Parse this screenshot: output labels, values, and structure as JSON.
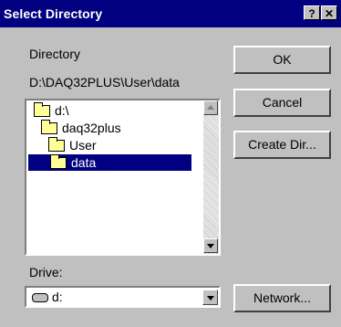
{
  "window": {
    "title": "Select Directory",
    "help_label": "?",
    "close_label": "✕"
  },
  "directory": {
    "label": "Directory",
    "path": "D:\\DAQ32PLUS\\User\\data"
  },
  "tree": {
    "items": [
      {
        "label": "d:\\",
        "selected": false
      },
      {
        "label": "daq32plus",
        "selected": false
      },
      {
        "label": "User",
        "selected": false
      },
      {
        "label": "data",
        "selected": true
      }
    ]
  },
  "drive": {
    "label": "Drive:",
    "value": "d:"
  },
  "buttons": {
    "ok": "OK",
    "cancel": "Cancel",
    "create_dir": "Create Dir...",
    "network": "Network..."
  },
  "colors": {
    "titlebar": "#000080",
    "selection": "#000080",
    "face": "#c0c0c0"
  }
}
